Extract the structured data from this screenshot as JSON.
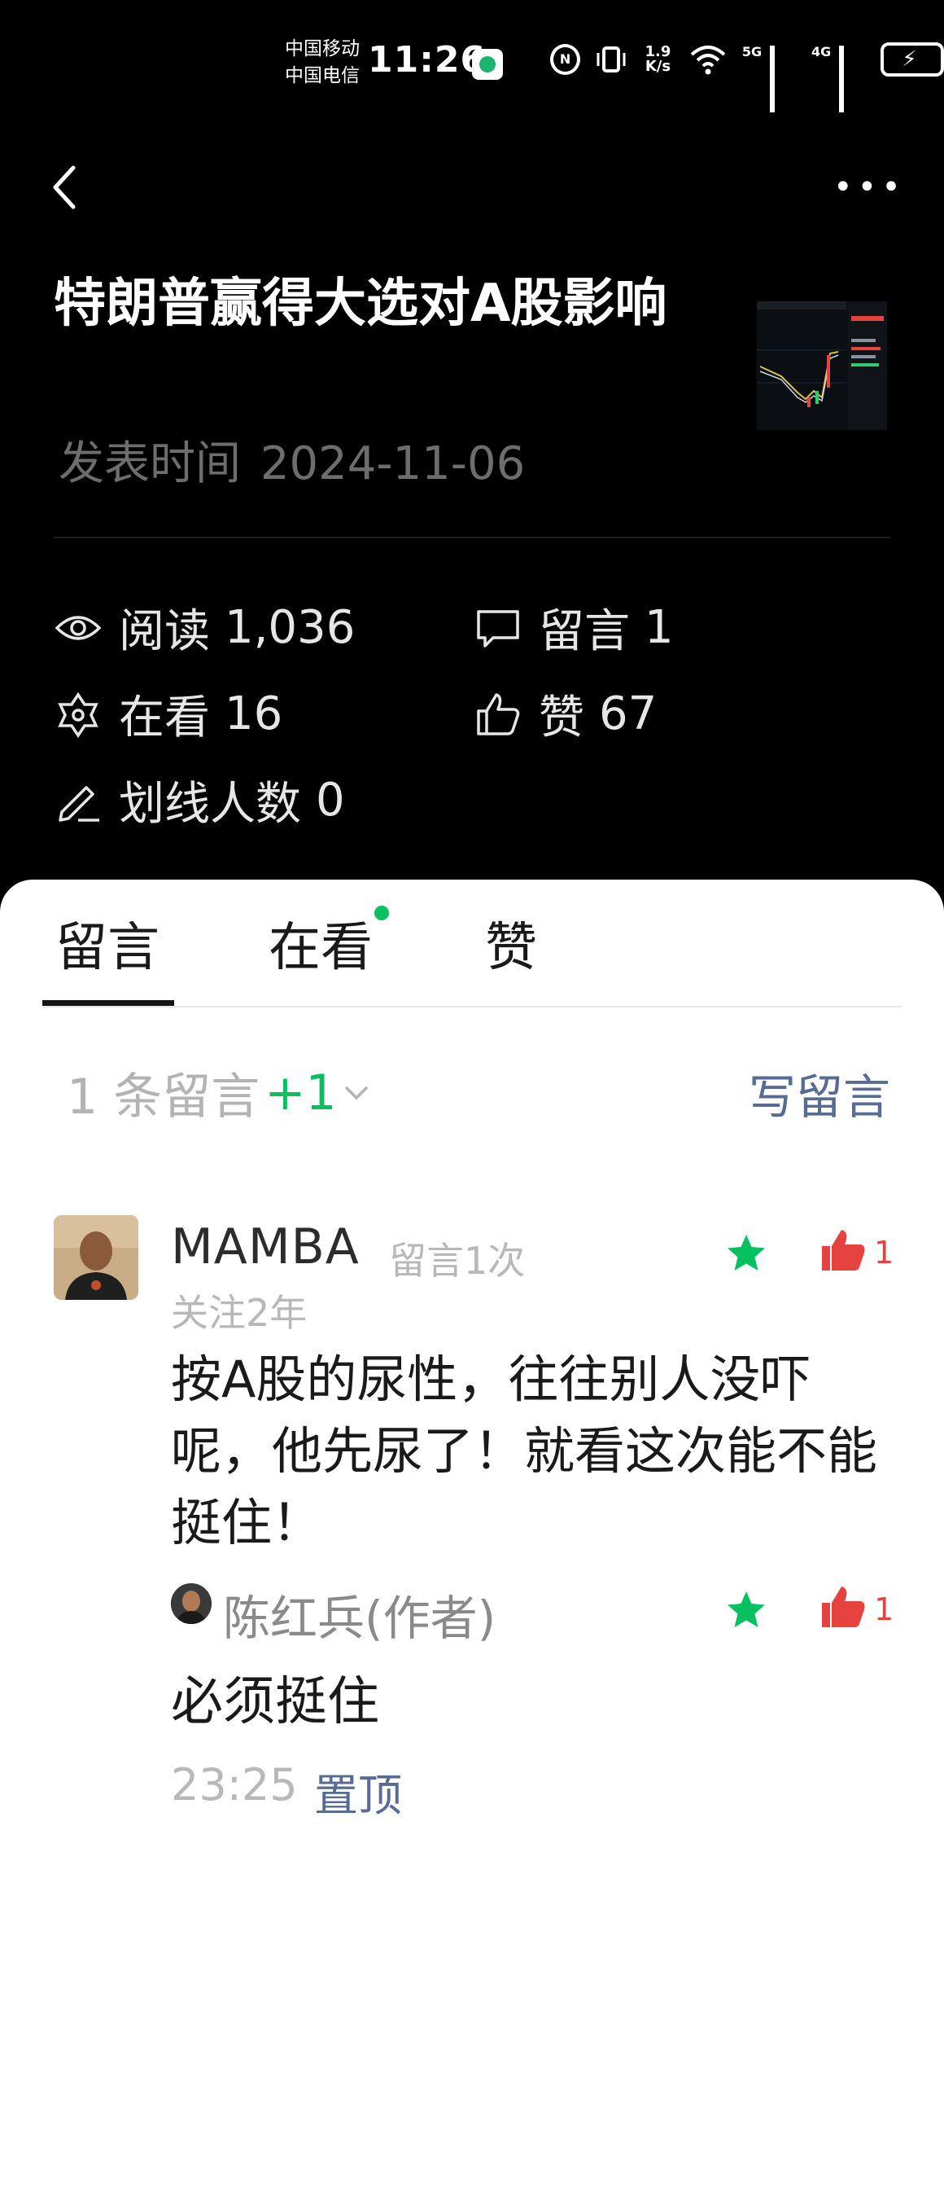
{
  "status_bar": {
    "carrier_1": "中国移动",
    "carrier_2": "中国电信",
    "time": "11:26",
    "nfc": "N",
    "speed_value": "1.9",
    "speed_unit": "K/s",
    "sig1_label": "5G",
    "sig2_label": "4G"
  },
  "article": {
    "title": "特朗普赢得大选对A股影响",
    "published_label": "发表时间",
    "published_date": "2024-11-06"
  },
  "stats": {
    "read_label": "阅读",
    "read_value": "1,036",
    "comment_label": "留言",
    "comment_value": "1",
    "watching_label": "在看",
    "watching_value": "16",
    "like_label": "赞",
    "like_value": "67",
    "underline_label": "划线人数",
    "underline_value": "0"
  },
  "tabs": {
    "comments": "留言",
    "watching": "在看",
    "likes": "赞"
  },
  "comments_header": {
    "count_text": "1 条留言",
    "new_count": "+1",
    "write_label": "写留言"
  },
  "comment": {
    "author": "MAMBA",
    "count_badge": "留言1次",
    "follow_duration": "关注2年",
    "text": "按A股的尿性，往往别人没吓呢，他先尿了！就看这次能不能挺住！",
    "likes": "1",
    "reply": {
      "author": "陈红兵(作者)",
      "text": "必须挺住",
      "likes": "1",
      "time": "23:25",
      "pin_label": "置顶"
    }
  },
  "colors": {
    "accent_green": "#07c160",
    "link_blue": "#576b95",
    "like_red": "#e64340",
    "background_dark": "#000000"
  }
}
